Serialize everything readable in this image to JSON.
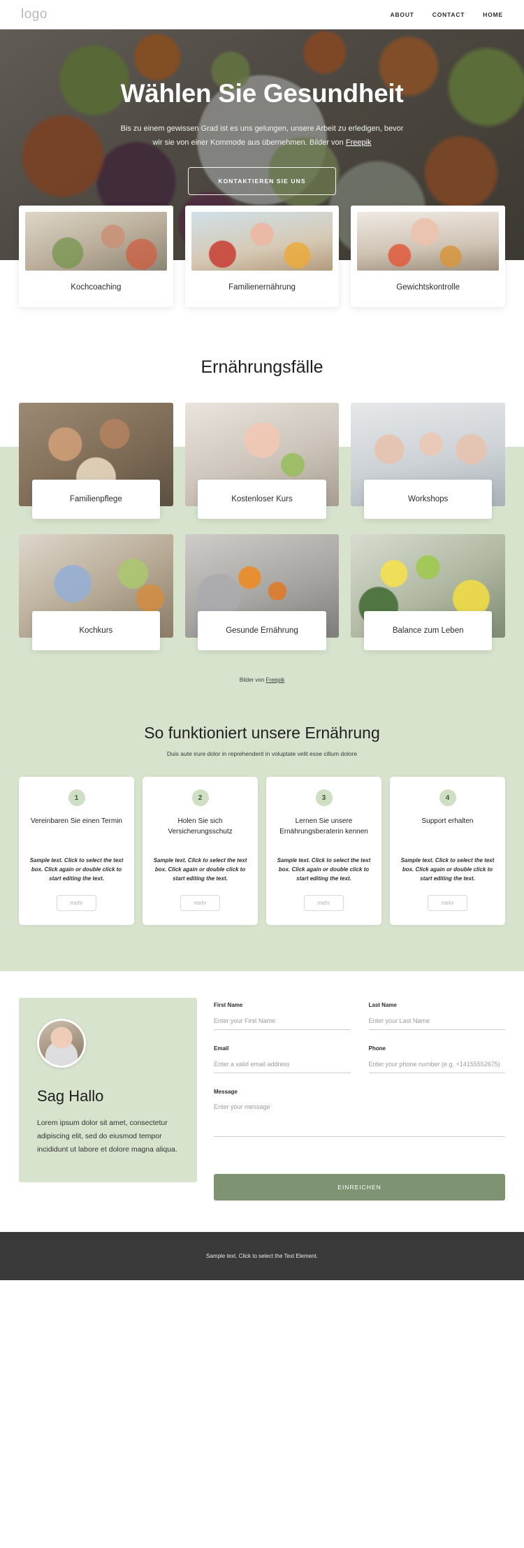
{
  "header": {
    "logo": "logo",
    "nav": [
      {
        "label": "ABOUT"
      },
      {
        "label": "CONTACT"
      },
      {
        "label": "HOME"
      }
    ]
  },
  "hero": {
    "title": "Wählen Sie Gesundheit",
    "subtitle_line1": "Bis zu einem gewissen Grad ist es uns gelungen, unsere Arbeit zu erledigen, bevor",
    "subtitle_line2": "wir sie von einer Kommode aus übernehmen. Bilder von ",
    "subtitle_link": "Freepik",
    "cta_label": "KONTAKTIEREN SIE UNS"
  },
  "services": [
    {
      "label": "Kochcoaching",
      "photo": "woman-cooking-in-kitchen-photo"
    },
    {
      "label": "Familienernährung",
      "photo": "mother-and-daughter-cooking-photo"
    },
    {
      "label": "Gewichtskontrolle",
      "photo": "woman-holding-apple-photo"
    }
  ],
  "gallery": {
    "title": "Ernährungsfälle",
    "items": [
      {
        "label": "Familienpflege",
        "photo": "family-dinner-table-photo"
      },
      {
        "label": "Kostenloser Kurs",
        "photo": "woman-with-green-apple-photo"
      },
      {
        "label": "Workshops",
        "photo": "family-group-portrait-photo"
      },
      {
        "label": "Kochkurs",
        "photo": "man-writing-notes-kitchen-photo"
      },
      {
        "label": "Gesunde Ernährung",
        "photo": "woman-peeling-orange-photo"
      },
      {
        "label": "Balance zum Leben",
        "photo": "blender-with-fruits-vegetables-photo"
      }
    ],
    "credit_prefix": "Bilder von ",
    "credit_link": "Freepik"
  },
  "steps_section": {
    "title": "So funktioniert unsere Ernährung",
    "subtitle": "Duis aute irure dolor in reprehenderit in voluptate velit esse cillum dolore",
    "steps": [
      {
        "number": "1",
        "heading": "Vereinbaren Sie einen Termin",
        "body": "Sample text. Click to select the text box. Click again or double click to start editing the text.",
        "button": "mehr"
      },
      {
        "number": "2",
        "heading": "Holen Sie sich Versicherungsschutz",
        "body": "Sample text. Click to select the text box. Click again or double click to start editing the text.",
        "button": "mehr"
      },
      {
        "number": "3",
        "heading": "Lernen Sie unsere Ernährungsberaterin kennen",
        "body": "Sample text. Click to select the text box. Click again or double click to start editing the text.",
        "button": "mehr"
      },
      {
        "number": "4",
        "heading": "Support erhalten",
        "body": "Sample text. Click to select the text box. Click again or double click to start editing the text.",
        "button": "mehr"
      }
    ]
  },
  "contact": {
    "avatar": "nutritionist-portrait-photo",
    "heading": "Sag Hallo",
    "text": "Lorem ipsum dolor sit amet, consectetur adipiscing elit, sed do eiusmod tempor incididunt ut labore et dolore magna aliqua.",
    "fields": {
      "first_name_label": "First Name",
      "first_name_placeholder": "Enter your First Name",
      "last_name_label": "Last Name",
      "last_name_placeholder": "Enter your Last Name",
      "email_label": "Email",
      "email_placeholder": "Enter a valid email address",
      "phone_label": "Phone",
      "phone_placeholder": "Enter your phone number (e.g. +14155552675)",
      "message_label": "Message",
      "message_placeholder": "Enter your message"
    },
    "submit_label": "EINREICHEN"
  },
  "footer": {
    "text": "Sample text. Click to select the Text Element."
  },
  "colors": {
    "band_green": "#d7e3cd",
    "submit_green": "#7d9372",
    "footer_dark": "#3a3a3a"
  }
}
